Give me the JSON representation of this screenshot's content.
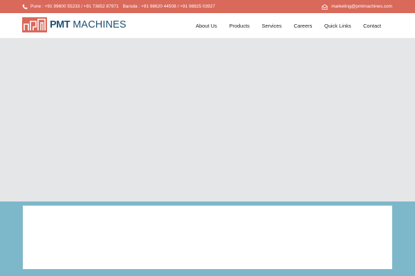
{
  "topbar": {
    "pune_label": "Pune : +91 99600 55233 / +91 73852 87971",
    "baroda_label": "Baroda : +91 98620 44508 / +91 98825 03927",
    "email": "marketing@pmtmachines.com",
    "phone_icon": "phone-icon",
    "mail_icon": "mail-icon"
  },
  "logo": {
    "brand_bold": "PMT",
    "brand_rest": " MACHINES"
  },
  "nav": {
    "items": [
      {
        "label": "About Us"
      },
      {
        "label": "Products"
      },
      {
        "label": "Services"
      },
      {
        "label": "Careers"
      },
      {
        "label": "Quick Links"
      },
      {
        "label": "Contact"
      }
    ]
  },
  "colors": {
    "topbar_bg": "#d9695a",
    "brand_blue": "#1c4f73",
    "hero_bg": "#e5e6e8",
    "lower_bg": "#7db8ca"
  }
}
